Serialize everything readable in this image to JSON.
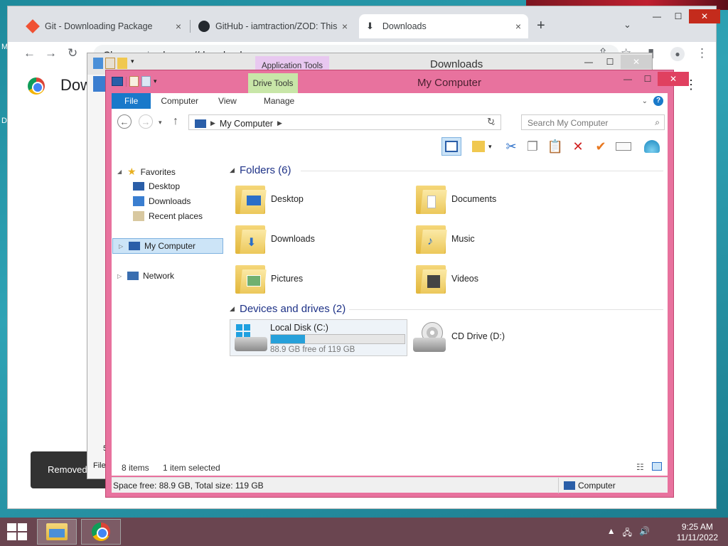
{
  "desktop": {
    "side_top": "M",
    "side_mid": "D"
  },
  "chrome": {
    "tabs": [
      {
        "title": "Git - Downloading Package"
      },
      {
        "title": "GitHub - iamtraction/ZOD: This is"
      },
      {
        "title": "Downloads"
      }
    ],
    "tab_close_glyph": "×",
    "new_tab_glyph": "+",
    "tab_dropdown_glyph": "⌄",
    "window_controls": {
      "minimize": "—",
      "maximize": "☐",
      "close": "✕"
    },
    "address": {
      "scheme_label": "Chrome",
      "url": "chrome://downloads"
    },
    "page": {
      "title": "Dow"
    },
    "toast": {
      "text": "Removed"
    }
  },
  "explorer_bg": {
    "title": "Downloads",
    "context_tab": "Application Tools",
    "status_fragment": "File",
    "side_digit": "5"
  },
  "explorer": {
    "title": "My Computer",
    "context_tab": "Drive Tools",
    "ribbon_tabs": {
      "file": "File",
      "computer": "Computer",
      "view": "View",
      "manage": "Manage"
    },
    "breadcrumb": "My Computer",
    "search_placeholder": "Search My Computer",
    "nav": {
      "favorites": "Favorites",
      "desktop": "Desktop",
      "downloads": "Downloads",
      "recent": "Recent places",
      "my_computer": "My Computer",
      "network": "Network"
    },
    "folders_header": "Folders (6)",
    "folders": {
      "desktop": "Desktop",
      "documents": "Documents",
      "downloads": "Downloads",
      "music": "Music",
      "pictures": "Pictures",
      "videos": "Videos"
    },
    "devices_header": "Devices and drives (2)",
    "drives": {
      "c_name": "Local Disk (C:)",
      "c_free": "88.9 GB free of 119 GB",
      "c_used_fraction": 0.253,
      "d_name": "CD Drive (D:)"
    },
    "status": {
      "items": "8 items",
      "selected": "1 item selected",
      "space": "Space free: 88.9 GB, Total size: 119 GB",
      "location": "Computer"
    }
  },
  "taskbar": {
    "time": "9:25 AM",
    "date": "11/11/2022"
  },
  "colors": {
    "window_frame": "#e8729e",
    "accent": "#1979ca",
    "selection": "#cce4f7",
    "taskbar": "#6a4550"
  }
}
